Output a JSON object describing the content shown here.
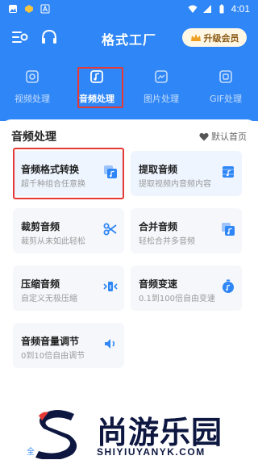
{
  "status_bar": {
    "time": "4:01"
  },
  "header": {
    "title": "格式工厂",
    "vip_label": "升级会员"
  },
  "tabs": [
    {
      "label": "视频处理",
      "icon": "video-tab-icon",
      "active": false
    },
    {
      "label": "音频处理",
      "icon": "audio-tab-icon",
      "active": true
    },
    {
      "label": "图片处理",
      "icon": "image-tab-icon",
      "active": false
    },
    {
      "label": "GIF处理",
      "icon": "gif-tab-icon",
      "active": false
    }
  ],
  "section": {
    "title": "音频处理",
    "default_home_label": "默认首页"
  },
  "cards": [
    {
      "title": "音频格式转换",
      "desc": "超千种组合任意换",
      "icon": "audio-convert-icon"
    },
    {
      "title": "提取音频",
      "desc": "提取视频内音频内容",
      "icon": "extract-audio-icon"
    },
    {
      "title": "裁剪音频",
      "desc": "裁剪从未如此轻松",
      "icon": "scissors-icon"
    },
    {
      "title": "合并音频",
      "desc": "轻松合并多音频",
      "icon": "merge-audio-icon"
    },
    {
      "title": "压缩音频",
      "desc": "自定义无极压缩",
      "icon": "compress-audio-icon"
    },
    {
      "title": "音频变速",
      "desc": "0.1到100倍自由变速",
      "icon": "speed-icon"
    },
    {
      "title": "音频音量调节",
      "desc": "0到10倍自由调节",
      "icon": "volume-icon"
    }
  ],
  "watermark": {
    "brand": "尚游乐园",
    "url": "SHIYIUYANYK.COM"
  },
  "bottom_partial_text": "全",
  "colors": {
    "primary": "#2f86f6",
    "vip_bg": "#fff7e6",
    "vip_text": "#8a5a14",
    "card_bg": "#f5f7fa",
    "highlight": "#e53935"
  }
}
